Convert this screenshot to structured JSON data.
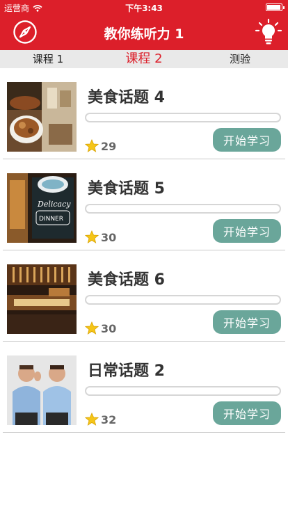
{
  "status_bar": {
    "carrier": "运营商",
    "time": "下午3:43"
  },
  "nav": {
    "title": "教你练听力 1",
    "left_icon": "compass-icon",
    "right_icon": "lightbulb-icon"
  },
  "tabs": [
    {
      "label": "课程 1",
      "active": false
    },
    {
      "label": "课程 2",
      "active": true
    },
    {
      "label": "测验",
      "active": false
    }
  ],
  "lessons": [
    {
      "title": "美食话题 4",
      "stars": "29",
      "button": "开始学习",
      "progress": 0
    },
    {
      "title": "美食话题 5",
      "stars": "30",
      "button": "开始学习",
      "progress": 0
    },
    {
      "title": "美食话题 6",
      "stars": "30",
      "button": "开始学习",
      "progress": 0
    },
    {
      "title": "日常话题 2",
      "stars": "32",
      "button": "开始学习",
      "progress": 0
    }
  ],
  "colors": {
    "brand_red": "#dc1f2a",
    "button_teal": "#6aa69a",
    "star_gold": "#f5c518"
  }
}
